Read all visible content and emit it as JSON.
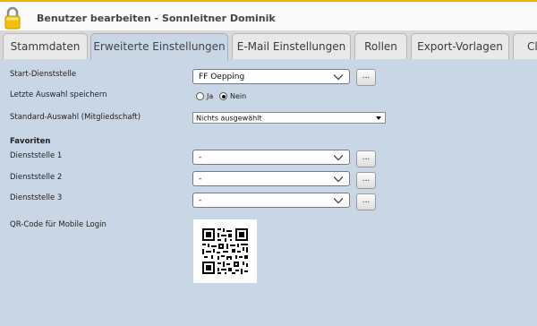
{
  "header": {
    "title": "Benutzer bearbeiten - Sonnleitner Dominik"
  },
  "tabs": [
    {
      "label": "Stammdaten",
      "active": false
    },
    {
      "label": "Erweiterte Einstellungen",
      "active": true
    },
    {
      "label": "E-Mail Einstellungen",
      "active": false
    },
    {
      "label": "Rollen",
      "active": false
    },
    {
      "label": "Export-Vorlagen",
      "active": false
    },
    {
      "label": "Cl",
      "active": false
    }
  ],
  "form": {
    "start_dienststelle": {
      "label": "Start-Dienststelle",
      "value": "FF Oepping",
      "button": "..."
    },
    "letzte_auswahl": {
      "label": "Letzte Auswahl speichern",
      "option_yes": "Ja",
      "option_no": "Nein",
      "selected": "Nein"
    },
    "standard_auswahl": {
      "label": "Standard-Auswahl (Mitgliedschaft)",
      "value": "Nichts ausgewählt"
    },
    "favoriten": {
      "title": "Favoriten",
      "items": [
        {
          "label": "Dienststelle 1",
          "value": "-",
          "button": "..."
        },
        {
          "label": "Dienststelle 2",
          "value": "-",
          "button": "..."
        },
        {
          "label": "Dienststelle 3",
          "value": "-",
          "button": "..."
        }
      ]
    },
    "qr": {
      "label": "QR-Code für Mobile Login"
    }
  },
  "icons": {
    "header": "lock-icon",
    "dropdown": "chevron-down-icon"
  },
  "colors": {
    "accent_line": "#f0b400",
    "content_bg": "#c9d6e5",
    "tab_bar": "#d9d9d9"
  }
}
